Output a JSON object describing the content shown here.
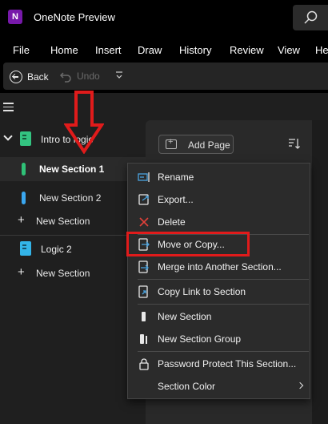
{
  "window": {
    "app_icon": "N",
    "title": "OneNote Preview"
  },
  "menu": [
    "File",
    "Home",
    "Insert",
    "Draw",
    "History",
    "Review",
    "View",
    "He"
  ],
  "toolbar": {
    "back_label": "Back",
    "undo_label": "Undo"
  },
  "notebooks": [
    {
      "name": "Intro to logic",
      "color": "#33c481",
      "expanded": true
    },
    {
      "name": "Logic 2",
      "color": "#33b4e8",
      "expanded": false
    }
  ],
  "sections": [
    {
      "name": "New Section 1",
      "color": "#2fc177",
      "selected": true
    },
    {
      "name": "New Section 2",
      "color": "#3aa7f0",
      "selected": false
    }
  ],
  "add_section_label": "New Section",
  "page_pane": {
    "add_page_label": "Add Page"
  },
  "context_menu": {
    "items": [
      {
        "label": "Rename",
        "icon": "rename-icon"
      },
      {
        "label": "Export...",
        "icon": "export-icon"
      },
      {
        "label": "Delete",
        "icon": "delete-icon"
      },
      {
        "label": "Move or Copy...",
        "icon": "move-copy-icon",
        "highlighted": true
      },
      {
        "label": "Merge into Another Section...",
        "icon": "merge-icon"
      },
      {
        "label": "Copy Link to Section",
        "icon": "link-icon"
      },
      {
        "label": "New Section",
        "icon": "new-section-icon"
      },
      {
        "label": "New Section Group",
        "icon": "new-section-group-icon"
      },
      {
        "label": "Password Protect This Section...",
        "icon": "lock-icon"
      },
      {
        "label": "Section Color",
        "icon": "submenu-chevron-icon",
        "has_submenu": true
      }
    ]
  },
  "colors": {
    "annotation_red": "#e01b1b",
    "delete_icon": "#e0413a",
    "accent_purple": "#7719aa"
  }
}
